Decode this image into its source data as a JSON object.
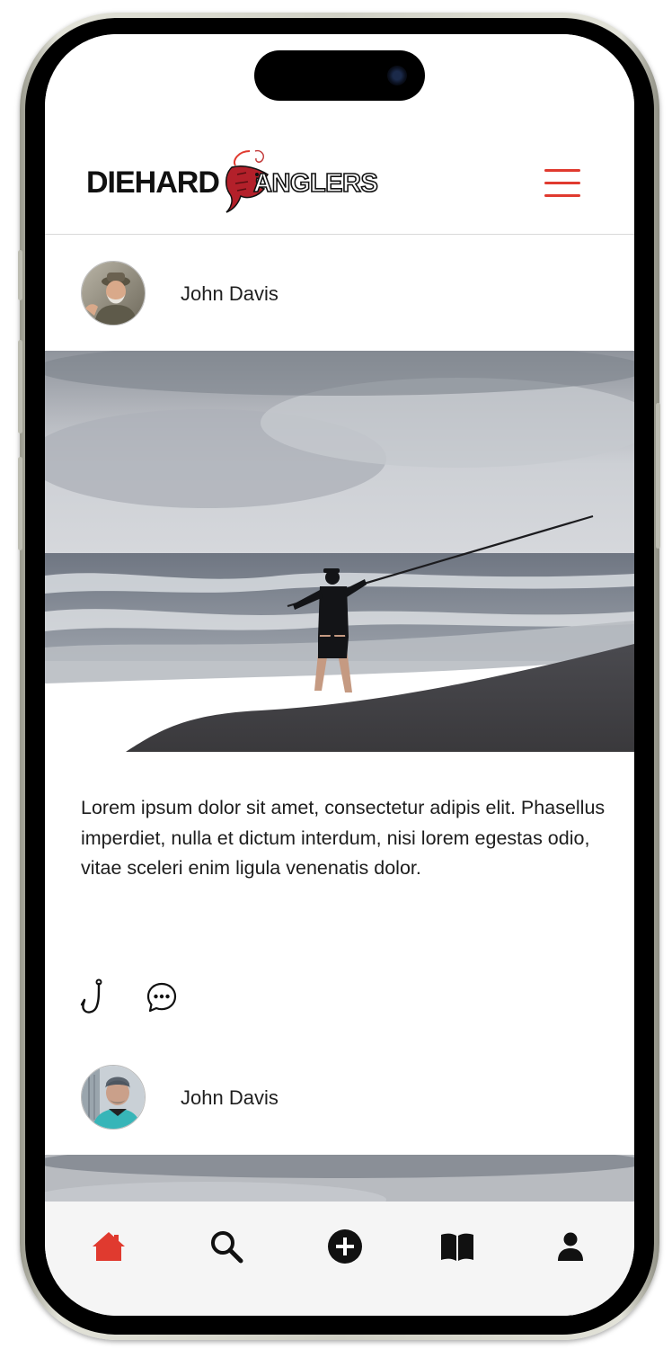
{
  "app": {
    "brand_left": "Diehard",
    "brand_right": "Anglers",
    "accent_color": "#e03a2f"
  },
  "header": {
    "menu_icon": "hamburger-menu-icon"
  },
  "posts": [
    {
      "author": "John Davis",
      "avatar": "avatar-elder-angler",
      "photo": "beach-fisherman-casting-photo",
      "text": "Lorem ipsum dolor sit amet, consectetur adipis elit. Phasellus imperdiet, nulla et dictum interdum, nisi lorem egestas odio, vitae sceleri enim ligula venenatis dolor.",
      "actions": [
        "hook-icon",
        "comment-icon"
      ]
    },
    {
      "author": "John Davis",
      "avatar": "avatar-beanie-angler",
      "photo": "cloudy-sky-photo"
    }
  ],
  "tabbar": {
    "items": [
      {
        "name": "home",
        "icon": "home-icon",
        "active": true
      },
      {
        "name": "search",
        "icon": "search-icon",
        "active": false
      },
      {
        "name": "add",
        "icon": "plus-circle-icon",
        "active": false
      },
      {
        "name": "guides",
        "icon": "book-icon",
        "active": false
      },
      {
        "name": "profile",
        "icon": "user-icon",
        "active": false
      }
    ],
    "active_color": "#e03a2f",
    "inactive_color": "#111111"
  }
}
